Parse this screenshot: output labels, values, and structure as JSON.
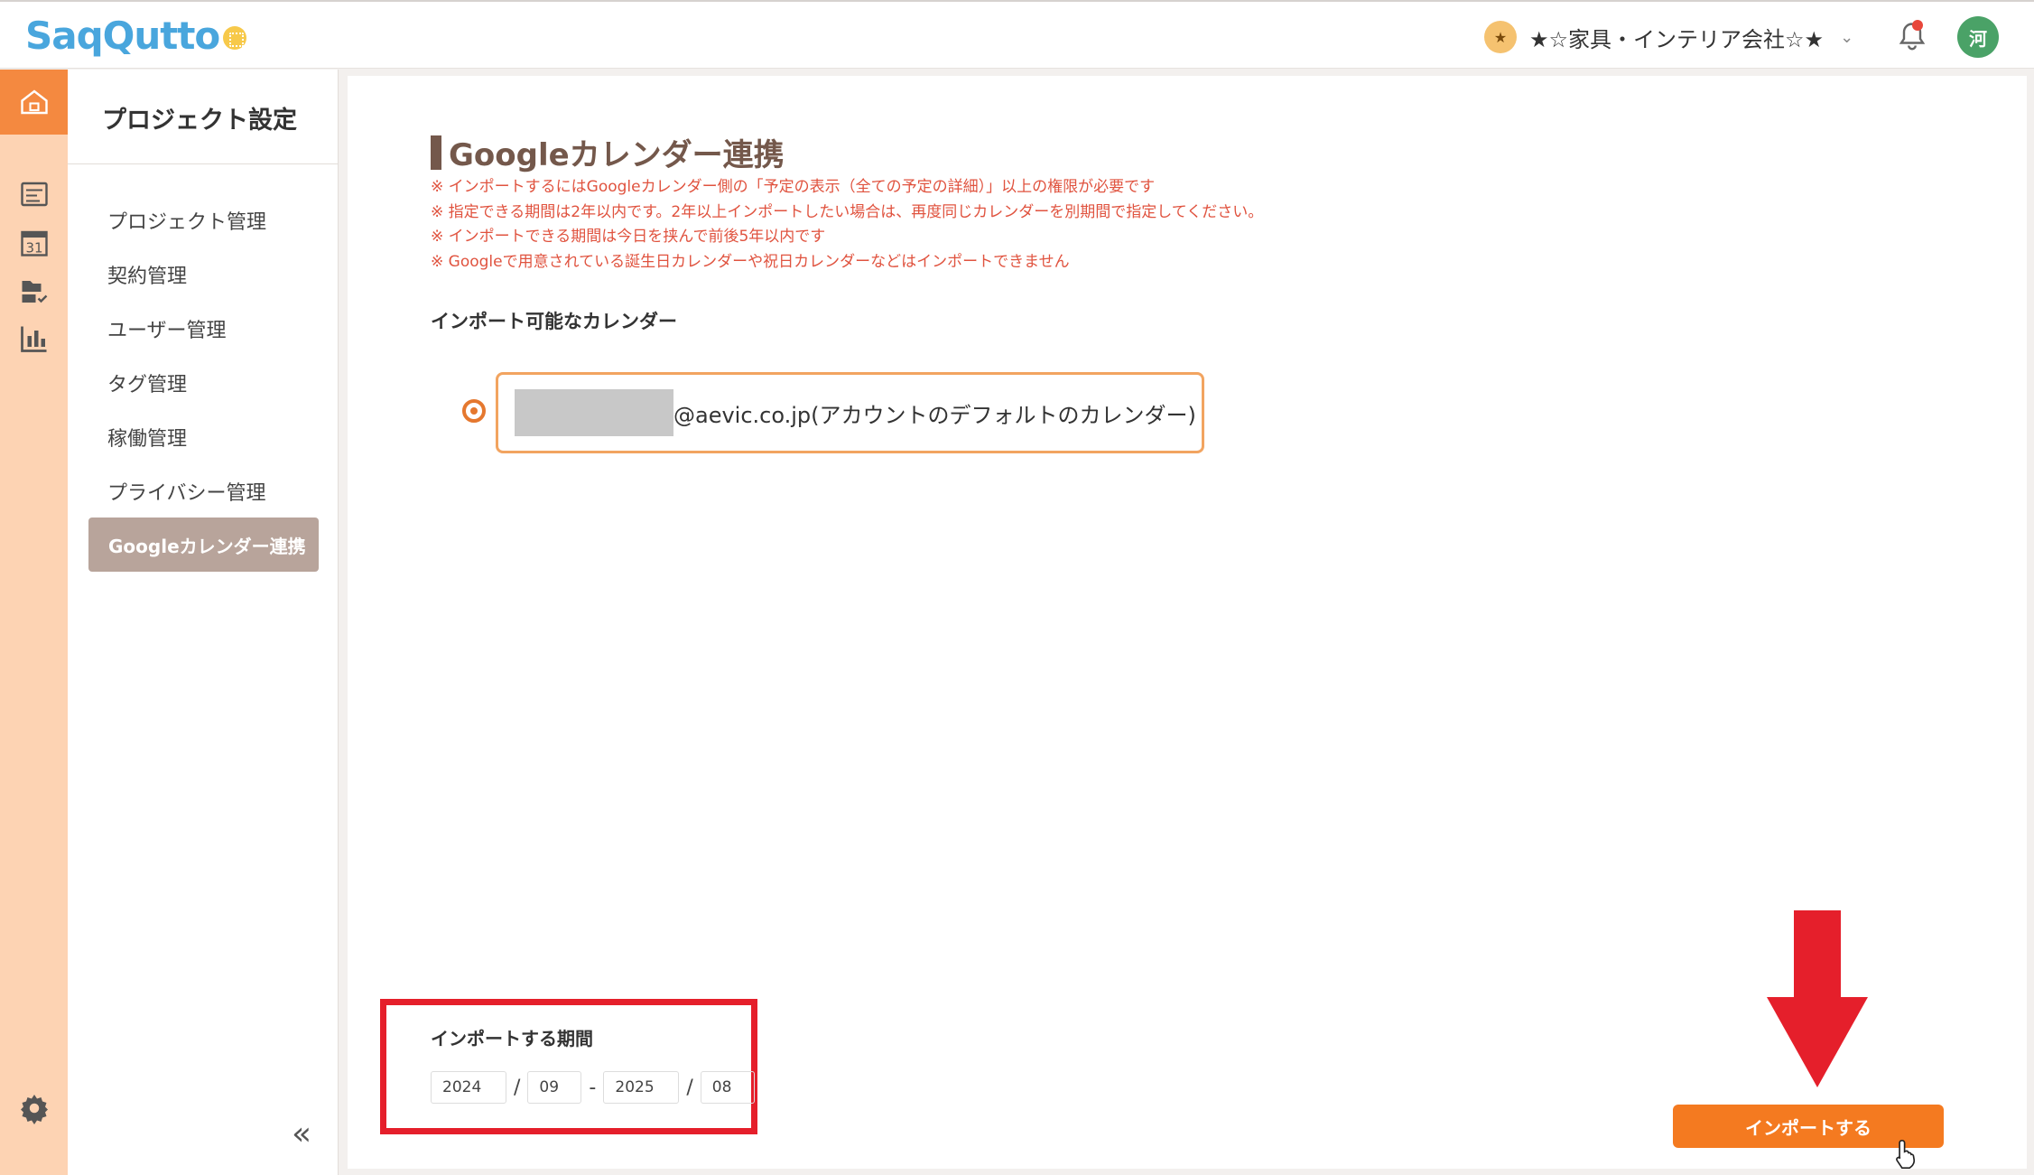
{
  "header": {
    "logo_text": "SaqQutto",
    "org_badge": "★",
    "org_name": "★☆家具・インテリア会社☆★",
    "chevron": "⌄",
    "avatar": "河"
  },
  "nav": {
    "title": "プロジェクト設定",
    "items": [
      {
        "label": "プロジェクト管理"
      },
      {
        "label": "契約管理"
      },
      {
        "label": "ユーザー管理"
      },
      {
        "label": "タグ管理"
      },
      {
        "label": "稼働管理"
      },
      {
        "label": "プライバシー管理"
      },
      {
        "label": "Googleカレンダー連携"
      }
    ],
    "collapse": "«"
  },
  "rail": {
    "icons": [
      "home-icon",
      "list-icon",
      "calendar-icon",
      "files-icon",
      "chart-icon",
      "settings-gear-icon"
    ],
    "calendar_number": "31"
  },
  "main": {
    "title": "Googleカレンダー連携",
    "notes": [
      "※ インポートするにはGoogleカレンダー側の「予定の表示（全ての予定の詳細）」以上の権限が必要です",
      "※ 指定できる期間は2年以内です。2年以上インポートしたい場合は、再度同じカレンダーを別期間で指定してください。",
      "※ インポートできる期間は今日を挟んで前後5年以内です",
      "※ Googleで用意されている誕生日カレンダーや祝日カレンダーなどはインポートできません"
    ],
    "import_available_label": "インポート可能なカレンダー",
    "calendar_option": "@aevic.co.jp(アカウントのデフォルトのカレンダー)",
    "period_label": "インポートする期間",
    "period": {
      "start_year": "2024",
      "start_month": "09",
      "end_year": "2025",
      "end_month": "08",
      "slash": "/",
      "dash": "-"
    },
    "import_button": "インポートする"
  },
  "colors": {
    "accent": "#f47a20",
    "rail": "#fdd3b3",
    "title_brown": "#74584b",
    "note_red": "#e0533f",
    "annotation_red": "#e51f2b"
  }
}
